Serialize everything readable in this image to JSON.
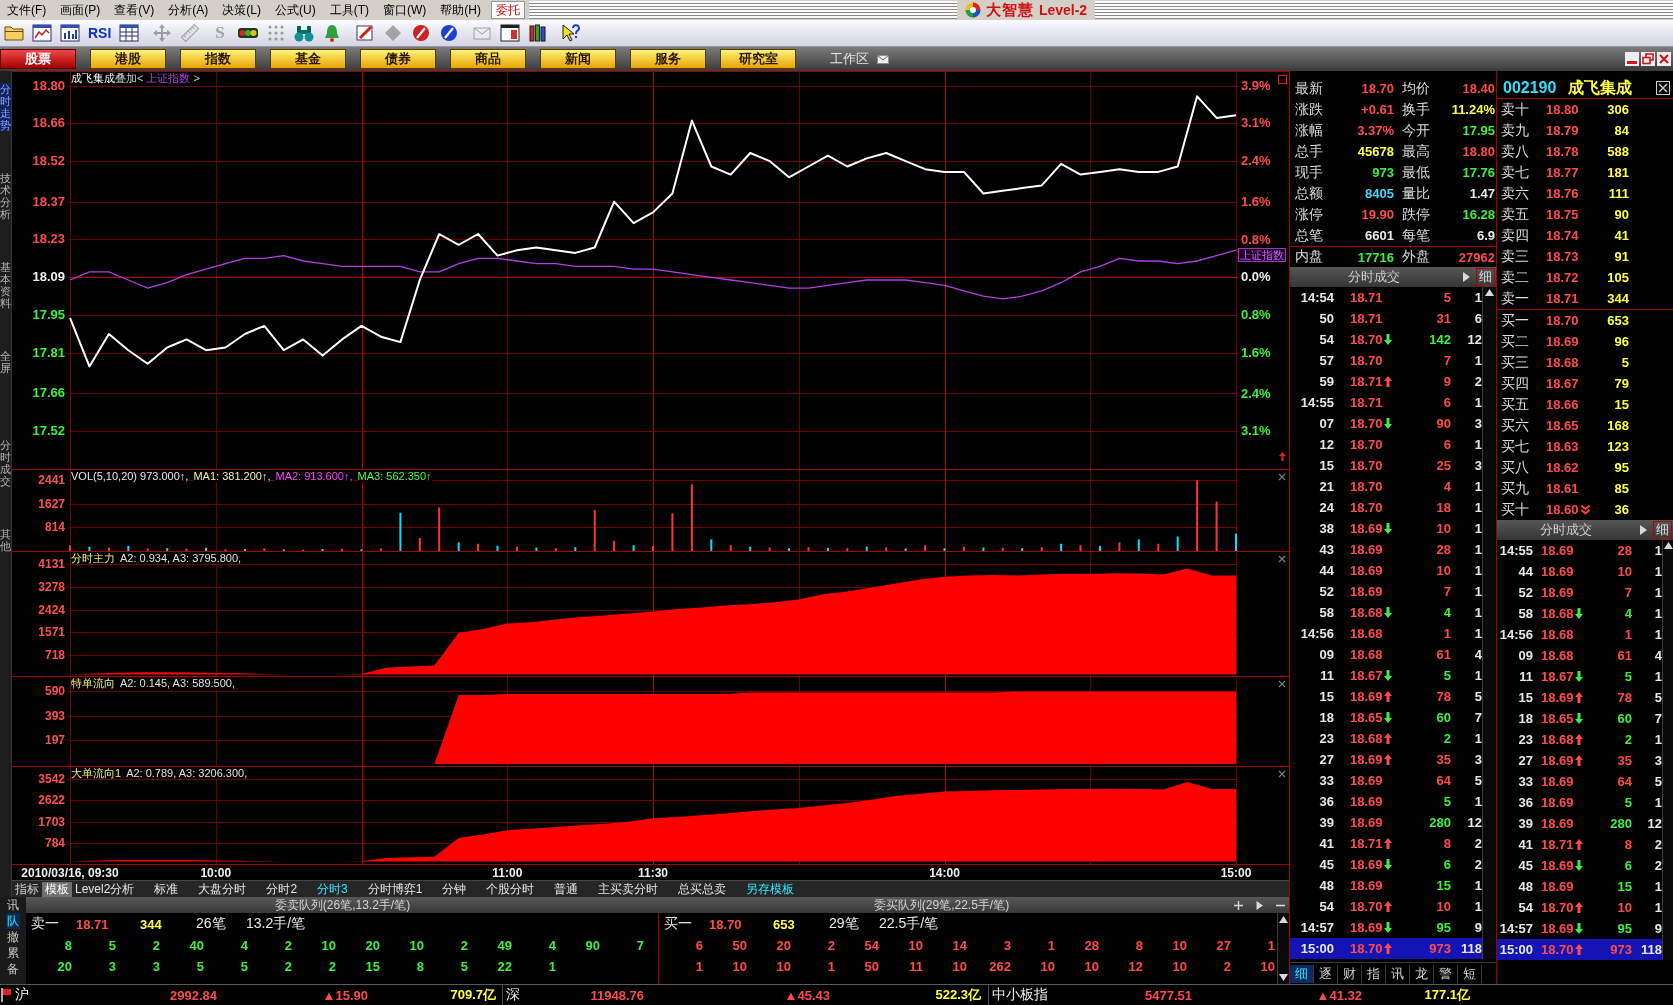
{
  "menu": {
    "items": [
      "文件(F)",
      "画面(P)",
      "查看(V)",
      "分析(A)",
      "决策(L)",
      "公式(U)",
      "工具(T)",
      "窗口(W)",
      "帮助(H)"
    ],
    "trade_button": "委托"
  },
  "title_logo": {
    "brand": "大智慧",
    "edition": "Level-2"
  },
  "toolbar": [
    {
      "disabled": false
    },
    {
      "disabled": false
    },
    {
      "disabled": false
    },
    {
      "label": "RSI",
      "disabled": false
    },
    {
      "disabled": false
    },
    {
      "disabled": true
    },
    {
      "disabled": true
    },
    {
      "label": "S",
      "disabled": true
    },
    {
      "disabled": false
    },
    {
      "disabled": true
    },
    {
      "disabled": false
    },
    {
      "disabled": false
    },
    {
      "disabled": false
    },
    {
      "disabled": true
    },
    {
      "disabled": false
    },
    {
      "disabled": false
    },
    {
      "disabled": true
    },
    {
      "disabled": false
    },
    {
      "disabled": false
    },
    {
      "disabled": false
    }
  ],
  "market_tabs": [
    {
      "label": "股票",
      "selected": true
    },
    {
      "label": "港股",
      "selected": false
    },
    {
      "label": "指数",
      "selected": false
    },
    {
      "label": "基金",
      "selected": false
    },
    {
      "label": "债券",
      "selected": false
    },
    {
      "label": "商品",
      "selected": false
    },
    {
      "label": "新闻",
      "selected": false
    },
    {
      "label": "服务",
      "selected": false
    },
    {
      "label": "研究室",
      "selected": false
    }
  ],
  "workspace": "工作区",
  "sidebar": [
    {
      "label": "分时走势",
      "selected": true
    },
    {
      "label": "技术分析",
      "selected": false
    },
    {
      "label": "基本资料",
      "selected": false
    },
    {
      "label": "全屏",
      "selected": false
    },
    {
      "label": "分时成交",
      "selected": false
    },
    {
      "label": "其他",
      "selected": false
    }
  ],
  "price_pane": {
    "title": "叠加<",
    "title_end": ">",
    "overlay_tag": "上证指数",
    "chart_data": {
      "type": "line",
      "grid": true,
      "categories": [
        null,
        null,
        null,
        null,
        null,
        null,
        null,
        null,
        null,
        null,
        null,
        null,
        null,
        null,
        null,
        null,
        null,
        null,
        null,
        null,
        null,
        null,
        null,
        null,
        null,
        null,
        null,
        null,
        null,
        null,
        null,
        null,
        null,
        null,
        null,
        null,
        null,
        null,
        null,
        null,
        null,
        null,
        null,
        null,
        null,
        null,
        null,
        null,
        null,
        null,
        null,
        null,
        null,
        null,
        null,
        null,
        null,
        null,
        null,
        null,
        null
      ],
      "ylim": [
        17.38,
        18.85
      ],
      "y2lim": [
        -3.92,
        4.2
      ],
      "series": [
        {
          "name": "成飞集成",
          "color": "#ffffff",
          "values": [
            17.94,
            17.76,
            17.88,
            17.82,
            17.77,
            17.83,
            17.86,
            17.82,
            17.83,
            17.88,
            17.91,
            17.82,
            17.86,
            17.8,
            17.86,
            17.91,
            17.87,
            17.85,
            18.08,
            18.25,
            18.21,
            18.25,
            18.17,
            18.19,
            18.2,
            18.19,
            18.18,
            18.2,
            18.37,
            18.29,
            18.33,
            18.4,
            18.67,
            18.5,
            18.47,
            18.55,
            18.52,
            18.46,
            18.5,
            18.54,
            18.5,
            18.53,
            18.55,
            18.52,
            18.49,
            18.48,
            18.48,
            18.4,
            18.41,
            18.42,
            18.43,
            18.51,
            18.47,
            18.48,
            18.49,
            18.48,
            18.48,
            18.5,
            18.76,
            18.68,
            18.69
          ]
        },
        {
          "name": "上证指数",
          "color": "#b040e0",
          "values": [
            18.08,
            18.11,
            18.11,
            18.08,
            18.05,
            18.07,
            18.1,
            18.12,
            18.14,
            18.16,
            18.16,
            18.17,
            18.15,
            18.14,
            18.13,
            18.13,
            18.13,
            18.13,
            18.11,
            18.11,
            18.14,
            18.16,
            18.16,
            18.15,
            18.14,
            18.14,
            18.13,
            18.13,
            18.13,
            18.12,
            18.12,
            18.11,
            18.1,
            18.09,
            18.08,
            18.07,
            18.06,
            18.05,
            18.05,
            18.06,
            18.07,
            18.08,
            18.08,
            18.08,
            18.07,
            18.06,
            18.04,
            18.02,
            18.01,
            18.02,
            18.04,
            18.07,
            18.11,
            18.13,
            18.16,
            18.15,
            18.15,
            18.14,
            18.15,
            18.17,
            18.19
          ]
        }
      ],
      "yticks": [
        {
          "value": 18.8,
          "label": "18.80"
        },
        {
          "value": 18.66,
          "label": "18.66"
        },
        {
          "value": 18.52,
          "label": "18.52"
        },
        {
          "value": 18.37,
          "label": "18.37"
        },
        {
          "value": 18.23,
          "label": "18.23"
        },
        {
          "value": 18.09,
          "label": "18.09"
        },
        {
          "value": 17.95,
          "label": "17.95"
        },
        {
          "value": 17.81,
          "label": "17.81"
        },
        {
          "value": 17.66,
          "label": "17.66"
        },
        {
          "value": 17.52,
          "label": "17.52"
        }
      ],
      "y2ticks": [
        {
          "value": 3.92,
          "label": "3.9%"
        },
        {
          "value": 3.15,
          "label": "3.1%"
        },
        {
          "value": 2.38,
          "label": "2.4%"
        },
        {
          "value": 1.55,
          "label": "1.6%"
        },
        {
          "value": 0.77,
          "label": "0.8%"
        },
        {
          "value": 0,
          "label": "0.0%"
        },
        {
          "value": -0.77,
          "label": "0.8%"
        },
        {
          "value": -1.55,
          "label": "1.6%"
        },
        {
          "value": -2.38,
          "label": "2.4%"
        },
        {
          "value": -3.15,
          "label": "3.1%"
        }
      ]
    }
  },
  "volume_pane": {
    "legend": [
      {
        "text": "VOL(5,10,20) 973.000↑,",
        "color": "#e8e8e8"
      },
      {
        "text": "MA1: 381.200↑,",
        "color": "#f0f0b0"
      },
      {
        "text": "MA2: 913.600↑,",
        "color": "#ff40ff"
      },
      {
        "text": "MA3: 562.350↑",
        "color": "#40ff40"
      }
    ],
    "chart_data": {
      "type": "bar",
      "grid": true,
      "stacked": true,
      "categories": [
        null,
        null,
        null,
        null,
        null,
        null,
        null,
        null,
        null,
        null,
        null,
        null,
        null,
        null,
        null,
        null,
        null,
        null,
        null,
        null,
        null,
        null,
        null,
        null,
        null,
        null,
        null,
        null,
        null,
        null,
        null,
        null,
        null,
        null,
        null,
        null,
        null,
        null,
        null,
        null,
        null,
        null,
        null,
        null,
        null,
        null,
        null,
        null,
        null,
        null,
        null,
        null,
        null,
        null,
        null,
        null,
        null,
        null,
        null,
        null,
        null
      ],
      "ylim": [
        0,
        2795
      ],
      "series": [
        {
          "color": "#ff3232",
          "values": [
            200,
            0,
            120,
            0,
            90,
            0,
            80,
            0,
            60,
            0,
            90,
            0,
            50,
            0,
            80,
            0,
            90,
            0,
            450,
            1500,
            0,
            250,
            0,
            140,
            0,
            100,
            0,
            1420,
            350,
            0,
            180,
            1300,
            2300,
            0,
            200,
            0,
            120,
            0,
            130,
            0,
            100,
            0,
            120,
            0,
            200,
            0,
            150,
            0,
            110,
            0,
            130,
            0,
            200,
            0,
            300,
            0,
            250,
            0,
            2440,
            1700,
            0
          ]
        },
        {
          "color": "#00e0ff",
          "values": [
            0,
            150,
            0,
            180,
            0,
            100,
            0,
            110,
            0,
            70,
            0,
            60,
            0,
            70,
            0,
            60,
            0,
            1320,
            0,
            0,
            300,
            0,
            180,
            0,
            120,
            0,
            130,
            0,
            0,
            200,
            0,
            0,
            0,
            400,
            0,
            150,
            0,
            100,
            0,
            110,
            0,
            150,
            0,
            90,
            0,
            100,
            0,
            120,
            0,
            100,
            0,
            250,
            0,
            180,
            0,
            400,
            0,
            500,
            0,
            0,
            600
          ]
        }
      ],
      "yticks": [
        {
          "value": 2441,
          "label": "2441"
        },
        {
          "value": 1627,
          "label": "1627"
        },
        {
          "value": 814,
          "label": "814"
        }
      ]
    }
  },
  "flow_panes": [
    {
      "name": "分时主力",
      "stats": "A2: 0.934, A3: 3795.800,",
      "chart_data": {
        "type": "area",
        "grid": true,
        "categories": [
          null,
          null,
          null,
          null,
          null,
          null,
          null,
          null,
          null,
          null,
          null,
          null,
          null,
          null,
          null,
          null,
          null,
          null,
          null,
          null,
          null,
          null,
          null,
          null,
          null,
          null,
          null,
          null,
          null,
          null,
          null,
          null,
          null,
          null,
          null,
          null,
          null,
          null,
          null,
          null,
          null,
          null,
          null,
          null,
          null,
          null,
          null,
          null,
          null
        ],
        "ylim": [
          -60,
          4576
        ],
        "series": [
          {
            "color": "#ff0000",
            "values": [
              0,
              30,
              60,
              80,
              80,
              70,
              50,
              40,
              20,
              0,
              0,
              0,
              20,
              250,
              300,
              330,
              1560,
              1700,
              1900,
              1950,
              2050,
              2150,
              2200,
              2280,
              2350,
              2450,
              2500,
              2580,
              2620,
              2700,
              2800,
              3000,
              3100,
              3250,
              3400,
              3550,
              3650,
              3700,
              3720,
              3700,
              3740,
              3760,
              3750,
              3780,
              3770,
              3740,
              3960,
              3700,
              3700
            ]
          }
        ],
        "yticks": [
          {
            "value": 4131,
            "label": "4131"
          },
          {
            "value": 3278,
            "label": "3278"
          },
          {
            "value": 2424,
            "label": "2424"
          },
          {
            "value": 1571,
            "label": "1571"
          },
          {
            "value": 718,
            "label": "718"
          }
        ]
      }
    },
    {
      "name": "特单流向",
      "stats": "A2: 0.145, A3: 589.500,",
      "chart_data": {
        "type": "area",
        "grid": true,
        "categories": [
          null,
          null,
          null,
          null,
          null,
          null,
          null,
          null,
          null,
          null,
          null,
          null,
          null,
          null,
          null,
          null,
          null,
          null,
          null,
          null,
          null,
          null,
          null,
          null,
          null,
          null,
          null,
          null,
          null,
          null,
          null,
          null,
          null,
          null,
          null,
          null,
          null,
          null,
          null,
          null,
          null,
          null,
          null,
          null,
          null,
          null,
          null,
          null,
          null
        ],
        "ylim": [
          -16,
          707
        ],
        "series": [
          {
            "color": "#ff0000",
            "values": [
              null,
              null,
              null,
              null,
              null,
              null,
              null,
              null,
              null,
              null,
              null,
              null,
              null,
              null,
              null,
              0,
              560,
              560,
              570,
              570,
              570,
              570,
              570,
              570,
              570,
              570,
              570,
              570,
              580,
              580,
              580,
              580,
              580,
              580,
              580,
              580,
              580,
              580,
              580,
              590,
              590,
              590,
              590,
              590,
              590,
              590,
              590,
              590,
              590
            ]
          }
        ],
        "yticks": [
          {
            "value": 590,
            "label": "590"
          },
          {
            "value": 393,
            "label": "393"
          },
          {
            "value": 197,
            "label": "197"
          }
        ]
      }
    },
    {
      "name": "大单流向1",
      "stats": "A2: 0.789, A3: 3206.300,",
      "chart_data": {
        "type": "area",
        "grid": true,
        "categories": [
          "2010/03/16, 09:30",
          null,
          null,
          null,
          null,
          null,
          "10:00",
          null,
          null,
          null,
          null,
          null,
          null,
          null,
          null,
          null,
          null,
          null,
          "11:00",
          null,
          null,
          null,
          null,
          null,
          "11:30",
          null,
          null,
          null,
          null,
          null,
          null,
          null,
          null,
          null,
          null,
          null,
          "14:00",
          null,
          null,
          null,
          null,
          null,
          null,
          null,
          null,
          null,
          null,
          null,
          "15:00"
        ],
        "ylim": [
          -106,
          4044
        ],
        "series": [
          {
            "color": "#ff0000",
            "values": [
              0,
              30,
              60,
              70,
              70,
              60,
              40,
              30,
              10,
              0,
              0,
              0,
              10,
              150,
              180,
              200,
              1000,
              1150,
              1340,
              1400,
              1480,
              1550,
              1620,
              1700,
              1850,
              1900,
              1980,
              2050,
              2150,
              2220,
              2290,
              2400,
              2500,
              2640,
              2800,
              2900,
              2990,
              3020,
              3050,
              3060,
              3080,
              3100,
              3100,
              3110,
              3100,
              3080,
              3400,
              3100,
              3100
            ]
          }
        ],
        "yticks": [
          {
            "value": 3542,
            "label": "3542"
          },
          {
            "value": 2622,
            "label": "2622"
          },
          {
            "value": 1703,
            "label": "1703"
          },
          {
            "value": 784,
            "label": "784"
          }
        ]
      }
    }
  ],
  "templates": [
    {
      "label": "指标",
      "kind": "tab",
      "selected": false
    },
    {
      "label": "模板",
      "kind": "tab",
      "selected": true
    },
    {
      "label": "Level2分析",
      "kind": "template",
      "selected": false
    },
    {
      "label": "标准",
      "kind": "template",
      "selected": false
    },
    {
      "label": "大盘分时",
      "kind": "template",
      "selected": false
    },
    {
      "label": "分时2",
      "kind": "template",
      "selected": false
    },
    {
      "label": "分时3",
      "kind": "template",
      "selected": true
    },
    {
      "label": "分时博弈1",
      "kind": "template",
      "selected": false
    },
    {
      "label": "分钟",
      "kind": "template",
      "selected": false
    },
    {
      "label": "个股分时",
      "kind": "template",
      "selected": false
    },
    {
      "label": "普通",
      "kind": "template",
      "selected": false
    },
    {
      "label": "主买卖分时",
      "kind": "template",
      "selected": false
    },
    {
      "label": "总买总卖",
      "kind": "template",
      "selected": false
    }
  ],
  "save_template": "另存模板",
  "queue": {
    "tabs": [
      {
        "label": "讯",
        "selected": false
      },
      {
        "label": "队",
        "selected": true
      },
      {
        "label": "撤",
        "selected": false
      },
      {
        "label": "累",
        "selected": false
      },
      {
        "label": "备",
        "selected": false
      }
    ],
    "panels": [
      {
        "title": "委卖队列(26笔,13.2手/笔)",
        "sell": true,
        "label": "卖一",
        "price": "18.71",
        "volume": "344",
        "orders": "26笔",
        "average": "13.2手/笔",
        "rows": [
          [
            "8",
            "5",
            "2",
            "40",
            "4",
            "2",
            "10",
            "20",
            "10",
            "2",
            "49",
            "4",
            "90",
            "7"
          ],
          [
            "20",
            "3",
            "3",
            "5",
            "5",
            "2",
            "2",
            "15",
            "8",
            "5",
            "22",
            "1"
          ]
        ]
      },
      {
        "title": "委买队列(29笔,22.5手/笔)",
        "sell": false,
        "label": "买一",
        "price": "18.70",
        "volume": "653",
        "orders": "29笔",
        "average": "22.5手/笔",
        "rows": [
          [
            "6",
            "50",
            "20",
            "2",
            "54",
            "10",
            "14",
            "3",
            "1",
            "28",
            "8",
            "10",
            "27",
            "1"
          ],
          [
            "1",
            "10",
            "10",
            "1",
            "50",
            "11",
            "10",
            "262",
            "10",
            "10",
            "12",
            "10",
            "2",
            "10"
          ]
        ]
      }
    ]
  },
  "quote": {
    "rows": [
      {
        "cells": [
          {
            "label": "最新",
            "value": "18.70",
            "color": "#ff4a4a"
          },
          {
            "label": "均价",
            "value": "18.40",
            "color": "#ff4a4a"
          }
        ]
      },
      {
        "cells": [
          {
            "label": "涨跌",
            "value": "+0.61",
            "color": "#ff4a4a"
          },
          {
            "label": "换手",
            "value": "11.24%",
            "color": "#ffff40"
          }
        ]
      },
      {
        "cells": [
          {
            "label": "涨幅",
            "value": "3.37%",
            "color": "#ff4a4a"
          },
          {
            "label": "今开",
            "value": "17.95",
            "color": "#3cf03c"
          }
        ]
      },
      {
        "cells": [
          {
            "label": "总手",
            "value": "45678",
            "color": "#ffff40"
          },
          {
            "label": "最高",
            "value": "18.80",
            "color": "#ff4a4a"
          }
        ]
      },
      {
        "cells": [
          {
            "label": "现手",
            "value": "973",
            "color": "#3cf03c"
          },
          {
            "label": "最低",
            "value": "17.76",
            "color": "#3cf03c"
          }
        ]
      },
      {
        "cells": [
          {
            "label": "总额",
            "value": "8405",
            "color": "#40d8ff"
          },
          {
            "label": "量比",
            "value": "1.47",
            "color": "#e8e8e8"
          }
        ]
      },
      {
        "cells": [
          {
            "label": "涨停",
            "value": "19.90",
            "color": "#ff4a4a"
          },
          {
            "label": "跌停",
            "value": "16.28",
            "color": "#3cf03c"
          }
        ]
      },
      {
        "cells": [
          {
            "label": "总笔",
            "value": "6601",
            "color": "#e8e8e8"
          },
          {
            "label": "每笔",
            "value": "6.9",
            "color": "#e8e8e8"
          }
        ]
      },
      {
        "cells": [
          {
            "label": "内盘",
            "value": "17716",
            "color": "#3cf03c"
          },
          {
            "label": "外盘",
            "value": "27962",
            "color": "#ff4a4a"
          }
        ]
      }
    ]
  },
  "order_book": {
    "code": "002190",
    "name": "成飞集成",
    "asks": [
      {
        "label": "卖十",
        "price": "18.80",
        "volume": "306",
        "arrow_down": false
      },
      {
        "label": "卖九",
        "price": "18.79",
        "volume": "84",
        "arrow_down": false
      },
      {
        "label": "卖八",
        "price": "18.78",
        "volume": "588",
        "arrow_down": false
      },
      {
        "label": "卖七",
        "price": "18.77",
        "volume": "181",
        "arrow_down": false
      },
      {
        "label": "卖六",
        "price": "18.76",
        "volume": "111",
        "arrow_down": false
      },
      {
        "label": "卖五",
        "price": "18.75",
        "volume": "90",
        "arrow_down": false
      },
      {
        "label": "卖四",
        "price": "18.74",
        "volume": "41",
        "arrow_down": false
      },
      {
        "label": "卖三",
        "price": "18.73",
        "volume": "91",
        "arrow_down": false
      },
      {
        "label": "卖二",
        "price": "18.72",
        "volume": "105",
        "arrow_down": false
      },
      {
        "label": "卖一",
        "price": "18.71",
        "volume": "344",
        "arrow_down": false
      }
    ],
    "bids": [
      {
        "label": "买一",
        "price": "18.70",
        "volume": "653",
        "arrow_down": false
      },
      {
        "label": "买二",
        "price": "18.69",
        "volume": "96",
        "arrow_down": false
      },
      {
        "label": "买三",
        "price": "18.68",
        "volume": "5",
        "arrow_down": false
      },
      {
        "label": "买四",
        "price": "18.67",
        "volume": "79",
        "arrow_down": false
      },
      {
        "label": "买五",
        "price": "18.66",
        "volume": "15",
        "arrow_down": false
      },
      {
        "label": "买六",
        "price": "18.65",
        "volume": "168",
        "arrow_down": false
      },
      {
        "label": "买七",
        "price": "18.63",
        "volume": "123",
        "arrow_down": false
      },
      {
        "label": "买八",
        "price": "18.62",
        "volume": "95",
        "arrow_down": false
      },
      {
        "label": "买九",
        "price": "18.61",
        "volume": "85",
        "arrow_down": false
      },
      {
        "label": "买十",
        "price": "18.60",
        "volume": "36",
        "arrow_down": true
      }
    ]
  },
  "tick_panels": [
    {
      "title": "分时成交",
      "detail": "细",
      "rows": [
        {
          "time": "14:54",
          "price": "18.71",
          "arrow_up": false,
          "arrow_down": false,
          "volume": "5",
          "sell": false,
          "count": "1",
          "selected": false
        },
        {
          "time": "50",
          "price": "18.71",
          "arrow_up": false,
          "arrow_down": false,
          "volume": "31",
          "sell": false,
          "count": "6",
          "selected": false
        },
        {
          "time": "54",
          "price": "18.70",
          "arrow_up": false,
          "arrow_down": true,
          "volume": "142",
          "sell": true,
          "count": "12",
          "selected": false
        },
        {
          "time": "57",
          "price": "18.70",
          "arrow_up": false,
          "arrow_down": false,
          "volume": "7",
          "sell": false,
          "count": "1",
          "selected": false
        },
        {
          "time": "59",
          "price": "18.71",
          "arrow_up": true,
          "arrow_down": false,
          "volume": "9",
          "sell": false,
          "count": "2",
          "selected": false
        },
        {
          "time": "14:55",
          "price": "18.71",
          "arrow_up": false,
          "arrow_down": false,
          "volume": "6",
          "sell": false,
          "count": "1",
          "selected": false
        },
        {
          "time": "07",
          "price": "18.70",
          "arrow_up": false,
          "arrow_down": true,
          "volume": "90",
          "sell": false,
          "count": "3",
          "selected": false
        },
        {
          "time": "12",
          "price": "18.70",
          "arrow_up": false,
          "arrow_down": false,
          "volume": "6",
          "sell": false,
          "count": "1",
          "selected": false
        },
        {
          "time": "15",
          "price": "18.70",
          "arrow_up": false,
          "arrow_down": false,
          "volume": "25",
          "sell": false,
          "count": "3",
          "selected": false
        },
        {
          "time": "21",
          "price": "18.70",
          "arrow_up": false,
          "arrow_down": false,
          "volume": "4",
          "sell": false,
          "count": "1",
          "selected": false
        },
        {
          "time": "24",
          "price": "18.70",
          "arrow_up": false,
          "arrow_down": false,
          "volume": "18",
          "sell": false,
          "count": "1",
          "selected": false
        },
        {
          "time": "38",
          "price": "18.69",
          "arrow_up": false,
          "arrow_down": true,
          "volume": "10",
          "sell": false,
          "count": "1",
          "selected": false
        },
        {
          "time": "43",
          "price": "18.69",
          "arrow_up": false,
          "arrow_down": false,
          "volume": "28",
          "sell": false,
          "count": "1",
          "selected": false
        },
        {
          "time": "44",
          "price": "18.69",
          "arrow_up": false,
          "arrow_down": false,
          "volume": "10",
          "sell": false,
          "count": "1",
          "selected": false
        },
        {
          "time": "52",
          "price": "18.69",
          "arrow_up": false,
          "arrow_down": false,
          "volume": "7",
          "sell": false,
          "count": "1",
          "selected": false
        },
        {
          "time": "58",
          "price": "18.68",
          "arrow_up": false,
          "arrow_down": true,
          "volume": "4",
          "sell": true,
          "count": "1",
          "selected": false
        },
        {
          "time": "14:56",
          "price": "18.68",
          "arrow_up": false,
          "arrow_down": false,
          "volume": "1",
          "sell": false,
          "count": "1",
          "selected": false
        },
        {
          "time": "09",
          "price": "18.68",
          "arrow_up": false,
          "arrow_down": false,
          "volume": "61",
          "sell": false,
          "count": "4",
          "selected": false
        },
        {
          "time": "11",
          "price": "18.67",
          "arrow_up": false,
          "arrow_down": true,
          "volume": "5",
          "sell": true,
          "count": "1",
          "selected": false
        },
        {
          "time": "15",
          "price": "18.69",
          "arrow_up": true,
          "arrow_down": false,
          "volume": "78",
          "sell": false,
          "count": "5",
          "selected": false
        },
        {
          "time": "18",
          "price": "18.65",
          "arrow_up": false,
          "arrow_down": true,
          "volume": "60",
          "sell": true,
          "count": "7",
          "selected": false
        },
        {
          "time": "23",
          "price": "18.68",
          "arrow_up": true,
          "arrow_down": false,
          "volume": "2",
          "sell": true,
          "count": "1",
          "selected": false
        },
        {
          "time": "27",
          "price": "18.69",
          "arrow_up": true,
          "arrow_down": false,
          "volume": "35",
          "sell": false,
          "count": "3",
          "selected": false
        },
        {
          "time": "33",
          "price": "18.69",
          "arrow_up": false,
          "arrow_down": false,
          "volume": "64",
          "sell": false,
          "count": "5",
          "selected": false
        },
        {
          "time": "36",
          "price": "18.69",
          "arrow_up": false,
          "arrow_down": false,
          "volume": "5",
          "sell": true,
          "count": "1",
          "selected": false
        },
        {
          "time": "39",
          "price": "18.69",
          "arrow_up": false,
          "arrow_down": false,
          "volume": "280",
          "sell": true,
          "count": "12",
          "selected": false
        },
        {
          "time": "41",
          "price": "18.71",
          "arrow_up": true,
          "arrow_down": false,
          "volume": "8",
          "sell": false,
          "count": "2",
          "selected": false
        },
        {
          "time": "45",
          "price": "18.69",
          "arrow_up": false,
          "arrow_down": true,
          "volume": "6",
          "sell": true,
          "count": "2",
          "selected": false
        },
        {
          "time": "48",
          "price": "18.69",
          "arrow_up": false,
          "arrow_down": false,
          "volume": "15",
          "sell": true,
          "count": "1",
          "selected": false
        },
        {
          "time": "54",
          "price": "18.70",
          "arrow_up": true,
          "arrow_down": false,
          "volume": "10",
          "sell": false,
          "count": "1",
          "selected": false
        },
        {
          "time": "14:57",
          "price": "18.69",
          "arrow_up": false,
          "arrow_down": true,
          "volume": "95",
          "sell": true,
          "count": "9",
          "selected": false
        },
        {
          "time": "15:00",
          "price": "18.70",
          "arrow_up": true,
          "arrow_down": false,
          "volume": "973",
          "sell": false,
          "count": "118",
          "selected": true
        }
      ]
    },
    {
      "title": "分时成交",
      "detail": "细",
      "rows": [
        {
          "time": "14:55",
          "price": "18.69",
          "arrow_up": false,
          "arrow_down": false,
          "volume": "28",
          "sell": false,
          "count": "1",
          "selected": false
        },
        {
          "time": "44",
          "price": "18.69",
          "arrow_up": false,
          "arrow_down": false,
          "volume": "10",
          "sell": false,
          "count": "1",
          "selected": false
        },
        {
          "time": "52",
          "price": "18.69",
          "arrow_up": false,
          "arrow_down": false,
          "volume": "7",
          "sell": false,
          "count": "1",
          "selected": false
        },
        {
          "time": "58",
          "price": "18.68",
          "arrow_up": false,
          "arrow_down": true,
          "volume": "4",
          "sell": true,
          "count": "1",
          "selected": false
        },
        {
          "time": "14:56",
          "price": "18.68",
          "arrow_up": false,
          "arrow_down": false,
          "volume": "1",
          "sell": false,
          "count": "1",
          "selected": false
        },
        {
          "time": "09",
          "price": "18.68",
          "arrow_up": false,
          "arrow_down": false,
          "volume": "61",
          "sell": false,
          "count": "4",
          "selected": false
        },
        {
          "time": "11",
          "price": "18.67",
          "arrow_up": false,
          "arrow_down": true,
          "volume": "5",
          "sell": true,
          "count": "1",
          "selected": false
        },
        {
          "time": "15",
          "price": "18.69",
          "arrow_up": true,
          "arrow_down": false,
          "volume": "78",
          "sell": false,
          "count": "5",
          "selected": false
        },
        {
          "time": "18",
          "price": "18.65",
          "arrow_up": false,
          "arrow_down": true,
          "volume": "60",
          "sell": true,
          "count": "7",
          "selected": false
        },
        {
          "time": "23",
          "price": "18.68",
          "arrow_up": true,
          "arrow_down": false,
          "volume": "2",
          "sell": true,
          "count": "1",
          "selected": false
        },
        {
          "time": "27",
          "price": "18.69",
          "arrow_up": true,
          "arrow_down": false,
          "volume": "35",
          "sell": false,
          "count": "3",
          "selected": false
        },
        {
          "time": "33",
          "price": "18.69",
          "arrow_up": false,
          "arrow_down": false,
          "volume": "64",
          "sell": false,
          "count": "5",
          "selected": false
        },
        {
          "time": "36",
          "price": "18.69",
          "arrow_up": false,
          "arrow_down": false,
          "volume": "5",
          "sell": true,
          "count": "1",
          "selected": false
        },
        {
          "time": "39",
          "price": "18.69",
          "arrow_up": false,
          "arrow_down": false,
          "volume": "280",
          "sell": true,
          "count": "12",
          "selected": false
        },
        {
          "time": "41",
          "price": "18.71",
          "arrow_up": true,
          "arrow_down": false,
          "volume": "8",
          "sell": false,
          "count": "2",
          "selected": false
        },
        {
          "time": "45",
          "price": "18.69",
          "arrow_up": false,
          "arrow_down": true,
          "volume": "6",
          "sell": true,
          "count": "2",
          "selected": false
        },
        {
          "time": "48",
          "price": "18.69",
          "arrow_up": false,
          "arrow_down": false,
          "volume": "15",
          "sell": true,
          "count": "1",
          "selected": false
        },
        {
          "time": "54",
          "price": "18.70",
          "arrow_up": true,
          "arrow_down": false,
          "volume": "10",
          "sell": false,
          "count": "1",
          "selected": false
        },
        {
          "time": "14:57",
          "price": "18.69",
          "arrow_up": false,
          "arrow_down": true,
          "volume": "95",
          "sell": true,
          "count": "9",
          "selected": false
        },
        {
          "time": "15:00",
          "price": "18.70",
          "arrow_up": true,
          "arrow_down": false,
          "volume": "973",
          "sell": false,
          "count": "118",
          "selected": true
        }
      ]
    }
  ],
  "info_tabs": [
    {
      "label": "细",
      "selected": true
    },
    {
      "label": "逐",
      "selected": false
    },
    {
      "label": "财",
      "selected": false
    },
    {
      "label": "指",
      "selected": false
    },
    {
      "label": "讯",
      "selected": false
    },
    {
      "label": "龙",
      "selected": false
    },
    {
      "label": "警",
      "selected": false
    },
    {
      "label": "短",
      "selected": false
    }
  ],
  "index_bar": [
    {
      "name": "沪",
      "value": "2992.84",
      "change": "▲15.90",
      "amount": "709.7亿"
    },
    {
      "name": "深",
      "value": "11948.76",
      "change": "▲45.43",
      "amount": "522.3亿"
    },
    {
      "name": "中小板指",
      "value": "5477.51",
      "change": "▲41.32",
      "amount": "177.1亿"
    }
  ]
}
